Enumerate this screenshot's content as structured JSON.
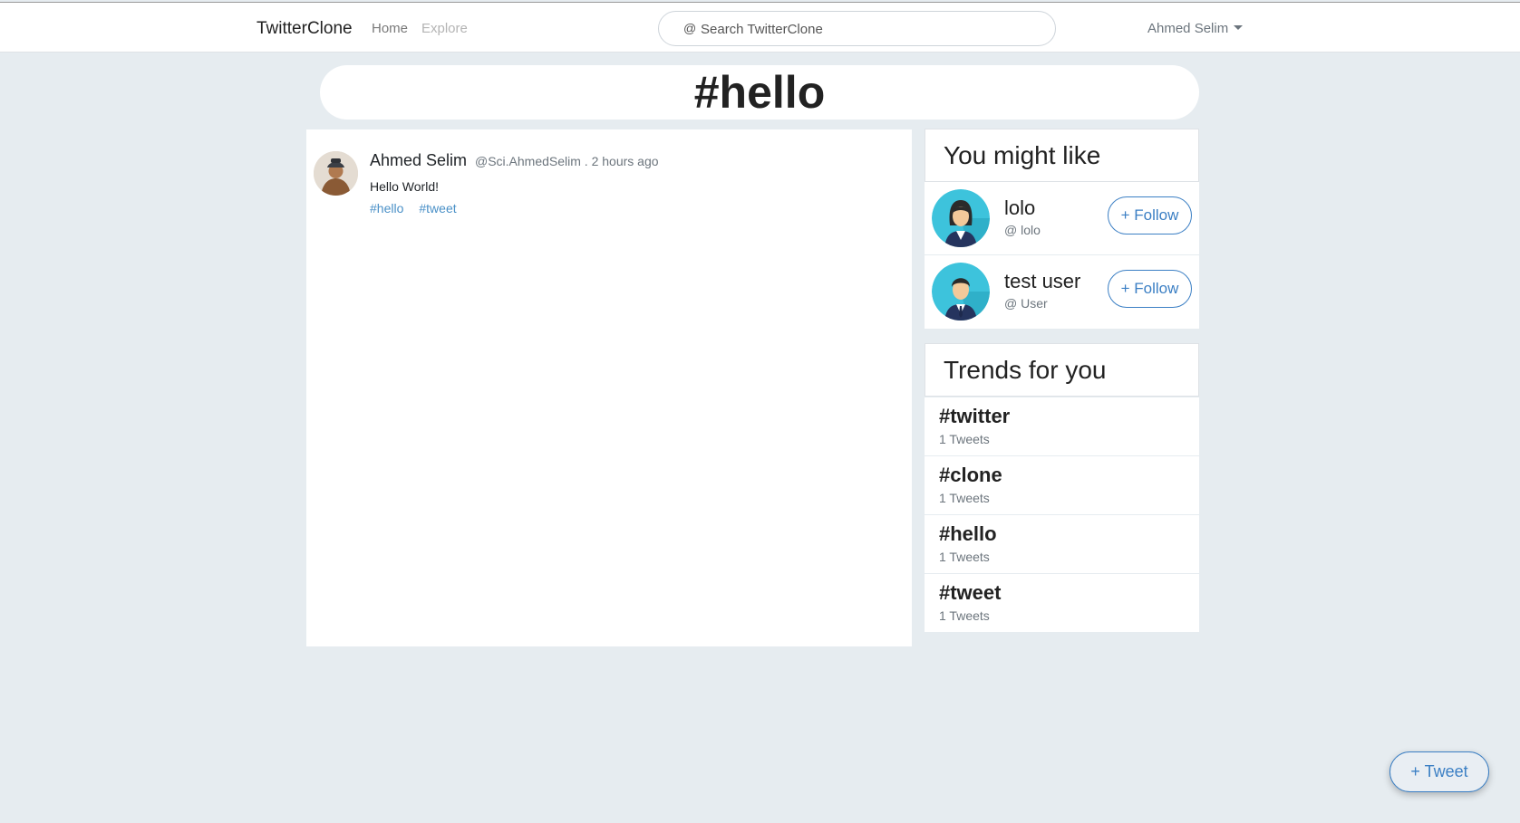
{
  "navbar": {
    "brand": "TwitterClone",
    "home": "Home",
    "explore": "Explore",
    "search_at": "@",
    "search_placeholder": "Search TwitterClone",
    "user": "Ahmed Selim"
  },
  "header": {
    "hashtag": "#hello"
  },
  "tweets": [
    {
      "name": "Ahmed Selim",
      "meta": "@Sci.AhmedSelim . 2 hours ago",
      "text": "Hello World!",
      "tags": [
        "#hello",
        "#tweet"
      ]
    }
  ],
  "suggestions": {
    "title": "You might like",
    "follow_label": "+ Follow",
    "users": [
      {
        "name": "lolo",
        "handle": "@ lolo"
      },
      {
        "name": "test user",
        "handle": "@ User"
      }
    ]
  },
  "trends": {
    "title": "Trends for you",
    "items": [
      {
        "tag": "#twitter",
        "count": "1 Tweets"
      },
      {
        "tag": "#clone",
        "count": "1 Tweets"
      },
      {
        "tag": "#hello",
        "count": "1 Tweets"
      },
      {
        "tag": "#tweet",
        "count": "1 Tweets"
      }
    ]
  },
  "fab": {
    "label": "+ Tweet"
  },
  "colors": {
    "accent": "#3b7fc4",
    "tag_link": "#4a90c7",
    "page_bg": "#e6ecf0"
  }
}
